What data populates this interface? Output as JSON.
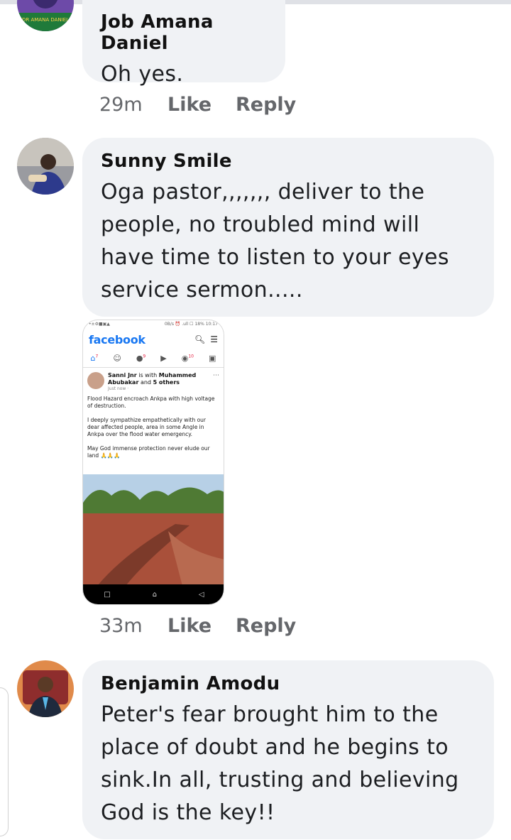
{
  "comments": [
    {
      "author": "Job Amana Daniel",
      "text": "Oh yes.",
      "time": "29m",
      "like": "Like",
      "reply": "Reply",
      "avatar_caption": "DR AMANA DANIEL"
    },
    {
      "author": "Sunny Smile",
      "text": "Oga pastor,,,,,,, deliver to the people,  no troubled mind will have time to listen to your eyes service sermon.....",
      "time": "33m",
      "like": "Like",
      "reply": "Reply"
    },
    {
      "author": "Benjamin Amodu",
      "text": "Peter's fear brought him to the place of doubt and he begins to sink.In all, trusting and believing God is the key!!"
    }
  ],
  "attachment": {
    "status_left": "•±⚙■▣▲",
    "status_right": "0B/s ⏰ .ull ☐ 18% 10:17",
    "app_name": "facebook",
    "post_author": "Sanni Jnr",
    "post_with": "is with",
    "post_tagged": "Muhammed Abubakar",
    "post_and": "and",
    "post_others": "5 others",
    "post_time": "Just now ·",
    "post_body": "Flood Hazard encroach Ankpa with high voltage of destruction.\n\nI deeply sympathize empathetically with our dear affected people, area in some Angle in Ankpa over the flood water emergency.\n\nMay God immense protection never elude our land 🙏🙏🙏",
    "tab_badges": [
      "7",
      "9",
      "10"
    ]
  },
  "colors": {
    "bubble": "#f0f2f5",
    "meta": "#65676b",
    "fb_blue": "#1877f2"
  }
}
